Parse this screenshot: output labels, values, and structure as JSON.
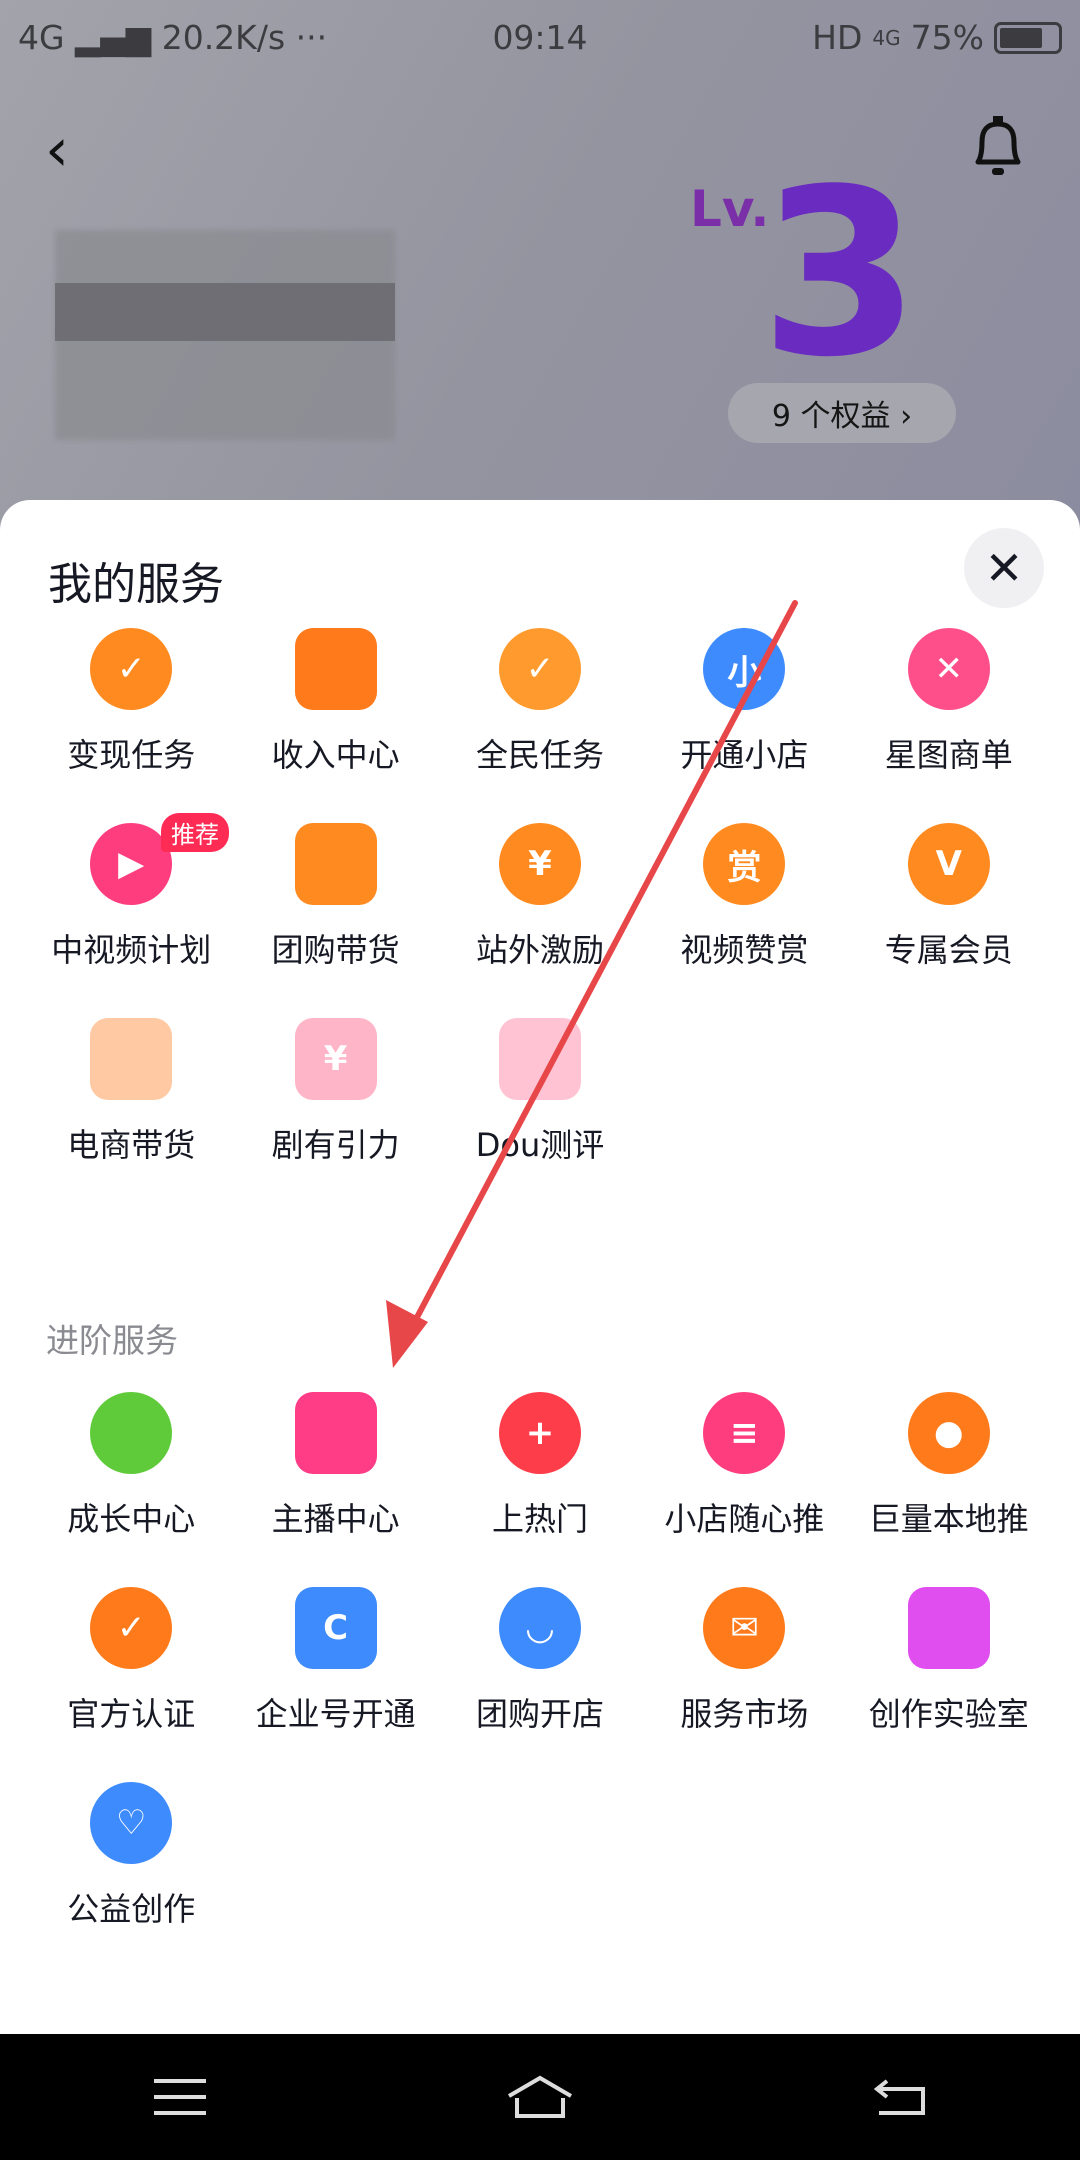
{
  "status_bar": {
    "network": "4G",
    "speed": "20.2K/s",
    "more": "···",
    "time": "09:14",
    "hd": "HD",
    "net2": "4G",
    "battery": "75%",
    "battery_level": 0.75
  },
  "header": {
    "level_prefix": "Lv.",
    "level": "3",
    "rights_label": "9 个权益 ›"
  },
  "sheet": {
    "title": "我的服务",
    "close": "✕",
    "my_services": [
      {
        "label": "变现任务",
        "icon": "trophy-icon",
        "color": "#ff8a1f",
        "glyph": "✓"
      },
      {
        "label": "收入中心",
        "icon": "wallet-icon",
        "color": "#ff7a1a",
        "glyph": ""
      },
      {
        "label": "全民任务",
        "icon": "people-icon",
        "color": "#ff9a2e",
        "glyph": "✓"
      },
      {
        "label": "开通小店",
        "icon": "shop-icon",
        "color": "#3d8bfd",
        "glyph": "小"
      },
      {
        "label": "星图商单",
        "icon": "star-map-icon",
        "color": "#fe4f8a",
        "glyph": "✕"
      },
      {
        "label": "中视频计划",
        "icon": "play-icon",
        "color": "#fe3d7f",
        "glyph": "▶",
        "badge": "推荐"
      },
      {
        "label": "团购带货",
        "icon": "store-icon",
        "color": "#ff8a1f",
        "glyph": ""
      },
      {
        "label": "站外激励",
        "icon": "video-yuan-icon",
        "color": "#ff8a1f",
        "glyph": "¥"
      },
      {
        "label": "视频赞赏",
        "icon": "reward-icon",
        "color": "#ff8a1f",
        "glyph": "赏"
      },
      {
        "label": "专属会员",
        "icon": "vip-icon",
        "color": "#ff8a1f",
        "glyph": "V"
      },
      {
        "label": "电商带货",
        "icon": "bag-locked-icon",
        "color": "#ffc9a3",
        "glyph": ""
      },
      {
        "label": "剧有引力",
        "icon": "drama-locked-icon",
        "color": "#ffb5c8",
        "glyph": "¥"
      },
      {
        "label": "Dou测评",
        "icon": "gift-locked-icon",
        "color": "#ffc3d3",
        "glyph": ""
      }
    ],
    "advanced_title": "进阶服务",
    "advanced_services": [
      {
        "label": "成长中心",
        "icon": "leaf-icon",
        "color": "#5fcb3a",
        "glyph": ""
      },
      {
        "label": "主播中心",
        "icon": "camera-icon",
        "color": "#fe3d86",
        "glyph": ""
      },
      {
        "label": "上热门",
        "icon": "flame-icon",
        "color": "#fe3d4a",
        "glyph": "+"
      },
      {
        "label": "小店随心推",
        "icon": "cart-icon",
        "color": "#fe3d7f",
        "glyph": "≡"
      },
      {
        "label": "巨量本地推",
        "icon": "location-icon",
        "color": "#ff7a1a",
        "glyph": "●"
      },
      {
        "label": "官方认证",
        "icon": "medal-icon",
        "color": "#ff7a1a",
        "glyph": "✓"
      },
      {
        "label": "企业号开通",
        "icon": "enterprise-icon",
        "color": "#3d8bfd",
        "glyph": "C"
      },
      {
        "label": "团购开店",
        "icon": "groupbuy-icon",
        "color": "#3d8bfd",
        "glyph": "◡"
      },
      {
        "label": "服务市场",
        "icon": "service-market-icon",
        "color": "#ff7a1a",
        "glyph": "✉"
      },
      {
        "label": "创作实验室",
        "icon": "flask-icon",
        "color": "#e04ef0",
        "glyph": ""
      },
      {
        "label": "公益创作",
        "icon": "charity-icon",
        "color": "#3d8bfd",
        "glyph": "♡"
      }
    ]
  },
  "annotation_color": "#e8474a"
}
